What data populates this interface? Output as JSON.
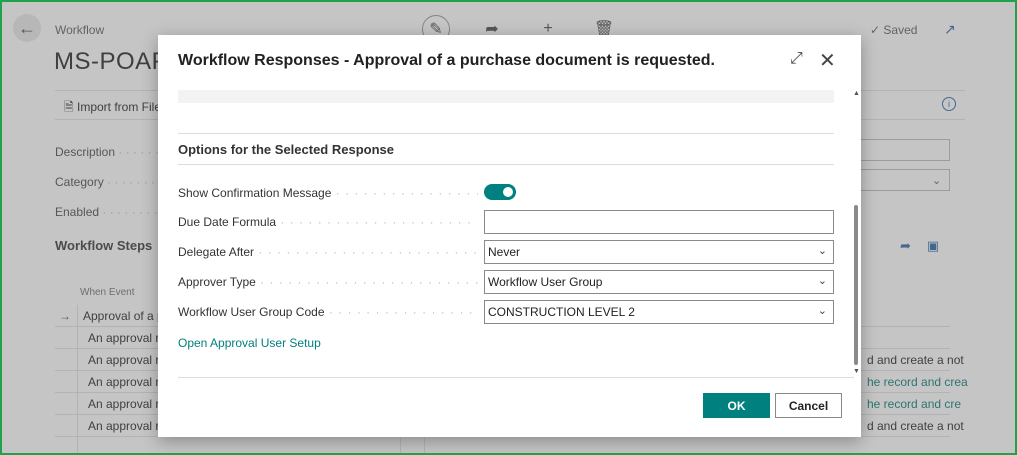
{
  "background": {
    "breadcrumb": "Workflow",
    "title": "MS-POAPV",
    "saved_label": "Saved",
    "import_label": "Import from File",
    "fields": [
      "Description",
      "Category",
      "Enabled"
    ],
    "section_title": "Workflow Steps",
    "column_header": "When Event",
    "rows": [
      {
        "event": "Approval of a p",
        "response": ""
      },
      {
        "event": "An approval re",
        "response": ""
      },
      {
        "event": "An approval re",
        "response": "d and create a not"
      },
      {
        "event": "An approval re",
        "response": "he record and crea"
      },
      {
        "event": "An approval re",
        "response": "he record and cre"
      },
      {
        "event": "An approval re",
        "response": "d and create a not"
      }
    ]
  },
  "dialog": {
    "title": "Workflow Responses - Approval of a purchase document is requested.",
    "section_title": "Options for the Selected Response",
    "fields": {
      "show_confirmation": {
        "label": "Show Confirmation Message",
        "checked": true
      },
      "due_date": {
        "label": "Due Date Formula",
        "value": ""
      },
      "delegate_after": {
        "label": "Delegate After",
        "value": "Never"
      },
      "approver_type": {
        "label": "Approver Type",
        "value": "Workflow User Group"
      },
      "user_group": {
        "label": "Workflow User Group Code",
        "value": "CONSTRUCTION LEVEL 2"
      }
    },
    "link_label": "Open Approval User Setup",
    "ok_label": "OK",
    "cancel_label": "Cancel"
  },
  "colors": {
    "accent": "#00807e",
    "frame": "#1fa34a",
    "link": "#00807e"
  }
}
